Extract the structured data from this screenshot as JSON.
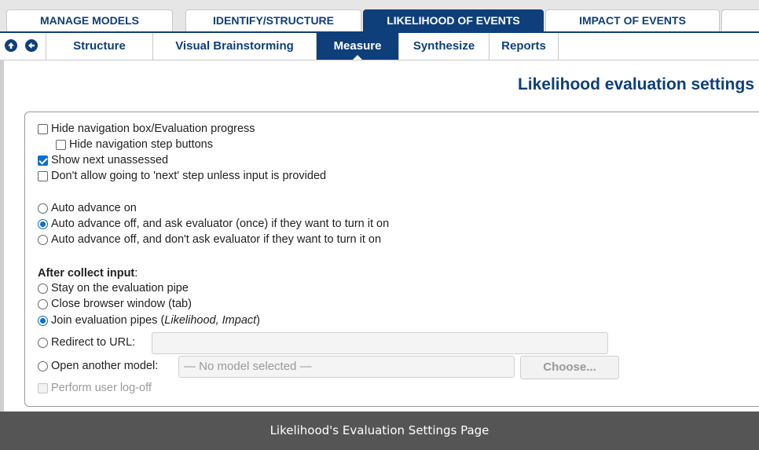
{
  "top_tabs": [
    {
      "label": "MANAGE MODELS"
    },
    {
      "label": "IDENTIFY/STRUCTURE"
    },
    {
      "label": "LIKELIHOOD OF EVENTS"
    },
    {
      "label": "IMPACT OF EVENTS"
    }
  ],
  "sub_nav": [
    {
      "label": "Structure"
    },
    {
      "label": "Visual Brainstorming"
    },
    {
      "label": "Measure"
    },
    {
      "label": "Synthesize"
    },
    {
      "label": "Reports"
    }
  ],
  "page_title": "Likelihood evaluation settings",
  "checkboxes": {
    "hide_nav_box": {
      "label": "Hide navigation box/Evaluation progress",
      "checked": false
    },
    "hide_nav_step": {
      "label": "Hide navigation step buttons",
      "checked": false
    },
    "show_next": {
      "label": "Show next unassessed",
      "checked": true
    },
    "dont_allow_next": {
      "label": "Don't allow going to 'next' step unless input is provided",
      "checked": false
    }
  },
  "auto_advance": {
    "on": "Auto advance on",
    "off_ask": "Auto advance off, and ask evaluator (once) if they want to turn it on",
    "off_no_ask": "Auto advance off, and don't ask evaluator if they want to turn it on",
    "selected": "off_ask"
  },
  "after_collect": {
    "label": "After collect input",
    "colon": ":",
    "stay": "Stay on the evaluation pipe",
    "close": "Close browser window (tab)",
    "join_prefix": "Join evaluation pipes (",
    "join_italic": "Likelihood, Impact",
    "join_suffix": ")",
    "redirect": "Redirect to URL:",
    "open_model": "Open another model:",
    "selected": "join"
  },
  "model_placeholder": "— No model selected —",
  "choose_button": "Choose...",
  "logoff_label": "Perform user log-off",
  "caption": "Likelihood's Evaluation Settings Page",
  "colors": {
    "accent": "#0f3f7a",
    "check": "#0b6fd1",
    "footer": "#555555"
  }
}
